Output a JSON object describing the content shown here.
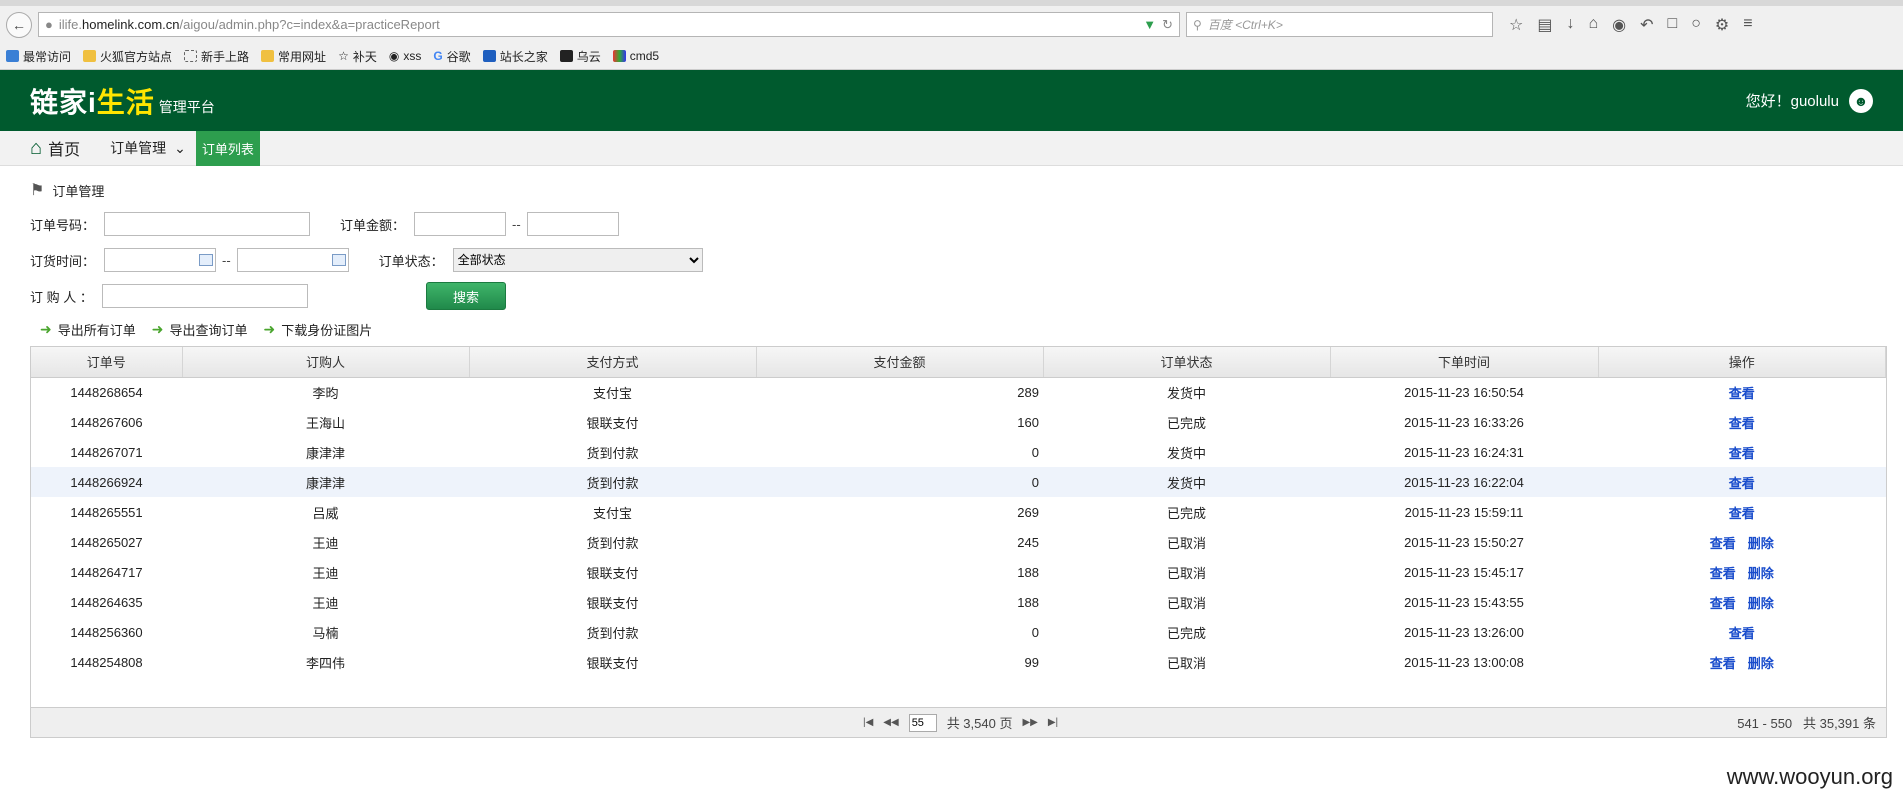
{
  "browser": {
    "url_prefix": "ilife.",
    "url_host": "homelink.com.cn",
    "url_path": "/aigou/admin.php?c=index&a=practiceReport",
    "search_placeholder": "百度 <Ctrl+K>"
  },
  "bookmarks": [
    "最常访问",
    "火狐官方站点",
    "新手上路",
    "常用网址",
    "补天",
    "xss",
    "谷歌",
    "站长之家",
    "乌云",
    "cmd5"
  ],
  "header": {
    "logo_main_1": "链家i",
    "logo_main_2": "生活",
    "logo_sub": "管理平台",
    "greeting": "您好！guolulu"
  },
  "menu": {
    "home": "首页",
    "order_mgmt": "订单管理",
    "active_item": "订单列表"
  },
  "section_title": "订单管理",
  "form": {
    "order_no_label": "订单号码：",
    "amount_label": "订单金额：",
    "order_time_label": "订货时间：",
    "status_label": "订单状态：",
    "status_value": "全部状态",
    "buyer_label": "订 购 人 ：",
    "dash": "--",
    "search_button": "搜索"
  },
  "exports": [
    "导出所有订单",
    "导出查询订单",
    "下载身份证图片"
  ],
  "table": {
    "columns": [
      "订单号",
      "订购人",
      "支付方式",
      "支付金额",
      "订单状态",
      "下单时间",
      "操作"
    ],
    "rows": [
      {
        "id": "1448268654",
        "buyer": "李昀",
        "pay": "支付宝",
        "amount": "289",
        "status": "发货中",
        "time": "2015-11-23 16:50:54",
        "actions": [
          "查看"
        ]
      },
      {
        "id": "1448267606",
        "buyer": "王海山",
        "pay": "银联支付",
        "amount": "160",
        "status": "已完成",
        "time": "2015-11-23 16:33:26",
        "actions": [
          "查看"
        ]
      },
      {
        "id": "1448267071",
        "buyer": "康津津",
        "pay": "货到付款",
        "amount": "0",
        "status": "发货中",
        "time": "2015-11-23 16:24:31",
        "actions": [
          "查看"
        ]
      },
      {
        "id": "1448266924",
        "buyer": "康津津",
        "pay": "货到付款",
        "amount": "0",
        "status": "发货中",
        "time": "2015-11-23 16:22:04",
        "actions": [
          "查看"
        ]
      },
      {
        "id": "1448265551",
        "buyer": "吕威",
        "pay": "支付宝",
        "amount": "269",
        "status": "已完成",
        "time": "2015-11-23 15:59:11",
        "actions": [
          "查看"
        ]
      },
      {
        "id": "1448265027",
        "buyer": "王迪",
        "pay": "货到付款",
        "amount": "245",
        "status": "已取消",
        "time": "2015-11-23 15:50:27",
        "actions": [
          "查看",
          "删除"
        ]
      },
      {
        "id": "1448264717",
        "buyer": "王迪",
        "pay": "银联支付",
        "amount": "188",
        "status": "已取消",
        "time": "2015-11-23 15:45:17",
        "actions": [
          "查看",
          "删除"
        ]
      },
      {
        "id": "1448264635",
        "buyer": "王迪",
        "pay": "银联支付",
        "amount": "188",
        "status": "已取消",
        "time": "2015-11-23 15:43:55",
        "actions": [
          "查看",
          "删除"
        ]
      },
      {
        "id": "1448256360",
        "buyer": "马楠",
        "pay": "货到付款",
        "amount": "0",
        "status": "已完成",
        "time": "2015-11-23 13:26:00",
        "actions": [
          "查看"
        ]
      },
      {
        "id": "1448254808",
        "buyer": "李四伟",
        "pay": "银联支付",
        "amount": "99",
        "status": "已取消",
        "time": "2015-11-23 13:00:08",
        "actions": [
          "查看",
          "删除"
        ]
      }
    ]
  },
  "pager": {
    "current_page": "55",
    "total_pages": "共 3,540 页",
    "range": "541 - 550",
    "total_items": "共 35,391 条"
  },
  "watermark": "www.wooyun.org",
  "colors": {
    "header_bg": "#005a2e",
    "logo_highlight": "#ffe500",
    "active_menu": "#2d9e4e",
    "link": "#1a4dcc"
  }
}
